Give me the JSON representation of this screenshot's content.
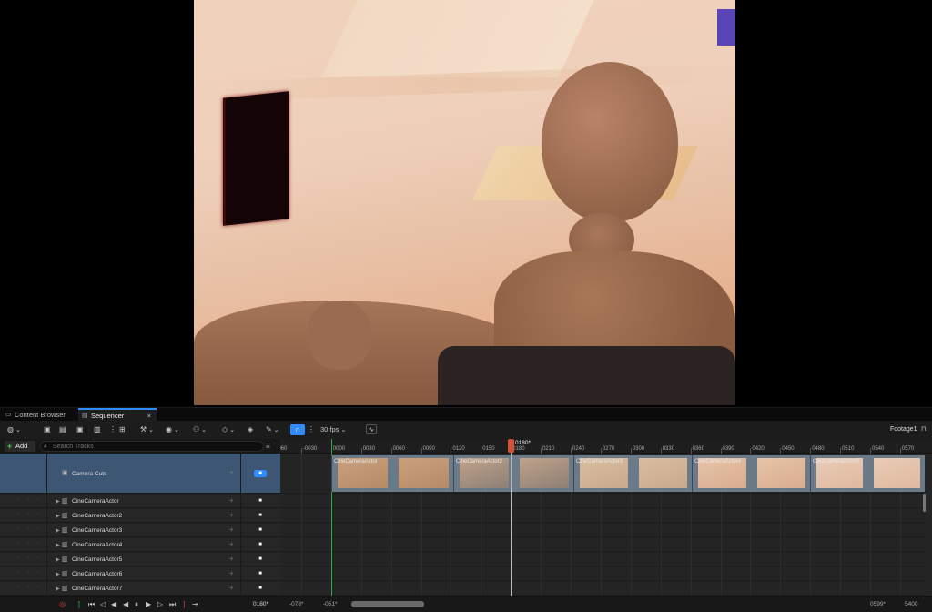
{
  "tabs": [
    {
      "label": "Content Browser",
      "icon": "folder-icon"
    },
    {
      "label": "Sequencer",
      "icon": "clapper-icon",
      "close": "×"
    }
  ],
  "toolbar": {
    "fps": "30 fps",
    "sequence_name": "Footage1"
  },
  "left_header": {
    "add_label": "Add",
    "search_placeholder": "Search Tracks"
  },
  "tracks": [
    {
      "name": "Camera Cuts"
    },
    {
      "name": "CineCameraActor"
    },
    {
      "name": "CineCameraActor2"
    },
    {
      "name": "CineCameraActor3"
    },
    {
      "name": "CineCameraActor4"
    },
    {
      "name": "CineCameraActor5"
    },
    {
      "name": "CineCameraActor6"
    },
    {
      "name": "CineCameraActor7"
    }
  ],
  "ruler": {
    "ticks": [
      "-0060",
      "-0030",
      "0000",
      "0030",
      "0060",
      "0090",
      "0120",
      "0150",
      "0180",
      "0210",
      "0240",
      "0270",
      "0300",
      "0330",
      "0360",
      "0390",
      "0420",
      "0450",
      "0480",
      "0510",
      "0540",
      "0570"
    ],
    "playhead_label": "0180*",
    "current_frame": 180
  },
  "shots": [
    {
      "label": "CineCameraActor"
    },
    {
      "label": "CineCameraActor2"
    },
    {
      "label": "CineCameraActor3"
    },
    {
      "label": "CineCameraActor4"
    },
    {
      "label": "CineCameraActor5"
    }
  ],
  "bottom": {
    "current_frame": "0180*",
    "view_start": "-078*",
    "play_start": "-051*",
    "view_end": "0599*",
    "end_frame": "5400"
  },
  "colors": {
    "accent": "#2f8cff",
    "playhead": "#d0543a",
    "camera_cuts_row": "#3d5673",
    "start_marker": "#2cab3e"
  }
}
